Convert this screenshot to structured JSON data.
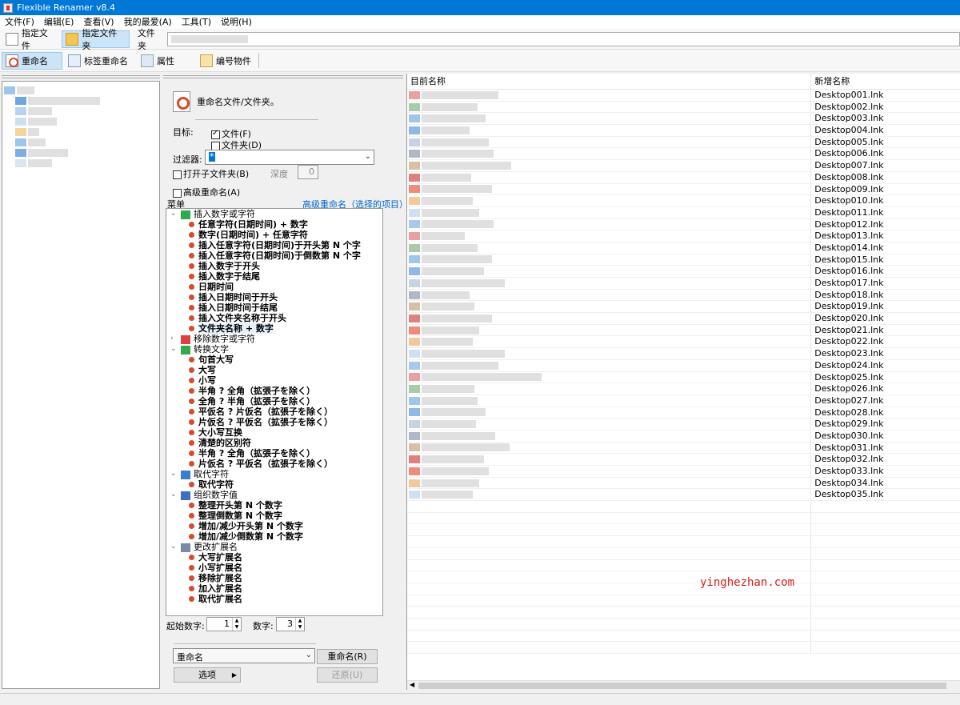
{
  "window": {
    "title": "Flexible Renamer v8.4"
  },
  "menu": [
    "文件(F)",
    "编辑(E)",
    "查看(V)",
    "我的最爱(A)",
    "工具(T)",
    "说明(H)"
  ],
  "toolbar1": {
    "specify_file": "指定文件",
    "specify_folder": "指定文件夹",
    "folder_label": "文件夹"
  },
  "toolbar2": {
    "rename": "重命名",
    "tag_rename": "标签重命名",
    "properties": "属性",
    "numbering": "编号物件"
  },
  "panel": {
    "heading": "重命名文件/文件夹。",
    "target_label": "目标:",
    "file_cb": "文件(F)",
    "folder_cb": "文件夹(D)",
    "filter_label": "过滤器:",
    "filter_value": "*",
    "open_subfolders": "打开子文件夹(B)",
    "depth_label": "深度",
    "depth_value": "0",
    "advanced": "高级重命名(A)",
    "menu_label": "菜单",
    "advanced_link": "高级重命名（选择的项目）",
    "start_number_label": "起始数字:",
    "start_number_value": "1",
    "digits_label": "数字:",
    "digits_value": "3",
    "mode_value": "重命名",
    "rename_button": "重命名(R)",
    "options_button": "选项",
    "restore_button": "还原(U)"
  },
  "tree": [
    {
      "type": "cat",
      "label": "插入数字或字符",
      "icon": "plus-icon"
    },
    {
      "type": "item",
      "label": "任意字符(日期时间) + 数字"
    },
    {
      "type": "item",
      "label": "数字(日期时间) + 任意字符"
    },
    {
      "type": "item",
      "label": "插入任意字符(日期时间)于开头第 N 个字"
    },
    {
      "type": "item",
      "label": "插入任意字符(日期时间)于倒数第 N 个字"
    },
    {
      "type": "item",
      "label": "插入数字于开头"
    },
    {
      "type": "item",
      "label": "插入数字于结尾"
    },
    {
      "type": "item",
      "label": "日期时间"
    },
    {
      "type": "item",
      "label": "插入日期时间于开头"
    },
    {
      "type": "item",
      "label": "插入日期时间于结尾"
    },
    {
      "type": "item",
      "label": "插入文件夹名称于开头"
    },
    {
      "type": "item",
      "label": "文件夹名称 + 数字",
      "selected": true
    },
    {
      "type": "cat",
      "label": "移除数字或字符",
      "icon": "remove-icon",
      "collapsed": true
    },
    {
      "type": "cat",
      "label": "转换文字",
      "icon": "convert-icon"
    },
    {
      "type": "item",
      "label": "句首大写"
    },
    {
      "type": "item",
      "label": "大写"
    },
    {
      "type": "item",
      "label": "小写"
    },
    {
      "type": "item",
      "label": "半角 ? 全角（拡張子を除く）"
    },
    {
      "type": "item",
      "label": "全角 ? 半角（拡張子を除く）"
    },
    {
      "type": "item",
      "label": "平仮名 ? 片仮名（拡張子を除く）"
    },
    {
      "type": "item",
      "label": "片仮名 ? 平仮名（拡張子を除く）"
    },
    {
      "type": "item",
      "label": "大小写互换"
    },
    {
      "type": "item",
      "label": "清楚的区别符"
    },
    {
      "type": "item",
      "label": "半角 ? 全角（拡張子を除く）"
    },
    {
      "type": "item",
      "label": "片仮名 ? 平仮名（拡張子を除く）"
    },
    {
      "type": "cat",
      "label": "取代字符",
      "icon": "replace-icon"
    },
    {
      "type": "item",
      "label": "取代字符"
    },
    {
      "type": "cat",
      "label": "组织数字值",
      "icon": "number-icon"
    },
    {
      "type": "item",
      "label": "整理开头第 N 个数字"
    },
    {
      "type": "item",
      "label": "整理倒数第 N 个数字"
    },
    {
      "type": "item",
      "label": "增加/减少开头第 N 个数字"
    },
    {
      "type": "item",
      "label": "增加/减少倒数第 N 个数字"
    },
    {
      "type": "cat",
      "label": "更改扩展名",
      "icon": "extension-icon"
    },
    {
      "type": "item",
      "label": "大写扩展名"
    },
    {
      "type": "item",
      "label": "小写扩展名"
    },
    {
      "type": "item",
      "label": "移除扩展名"
    },
    {
      "type": "item",
      "label": "加入扩展名"
    },
    {
      "type": "item",
      "label": "取代扩展名"
    }
  ],
  "filelist": {
    "col_current": "目前名称",
    "col_new": "新增名称",
    "new_names": [
      "Desktop001.lnk",
      "Desktop002.lnk",
      "Desktop003.lnk",
      "Desktop004.lnk",
      "Desktop005.lnk",
      "Desktop006.lnk",
      "Desktop007.lnk",
      "Desktop008.lnk",
      "Desktop009.lnk",
      "Desktop010.lnk",
      "Desktop011.lnk",
      "Desktop012.lnk",
      "Desktop013.lnk",
      "Desktop014.lnk",
      "Desktop015.lnk",
      "Desktop016.lnk",
      "Desktop017.lnk",
      "Desktop018.lnk",
      "Desktop019.lnk",
      "Desktop020.lnk",
      "Desktop021.lnk",
      "Desktop022.lnk",
      "Desktop023.lnk",
      "Desktop024.lnk",
      "Desktop025.lnk",
      "Desktop026.lnk",
      "Desktop027.lnk",
      "Desktop028.lnk",
      "Desktop029.lnk",
      "Desktop030.lnk",
      "Desktop031.lnk",
      "Desktop032.lnk",
      "Desktop033.lnk",
      "Desktop034.lnk",
      "Desktop035.lnk"
    ]
  },
  "watermark": "yinghezhan.com",
  "colors": {
    "titlebar": "#0078d7",
    "dot": "#d84a2e",
    "link": "#0066cc",
    "watermark": "#d81b1b"
  }
}
